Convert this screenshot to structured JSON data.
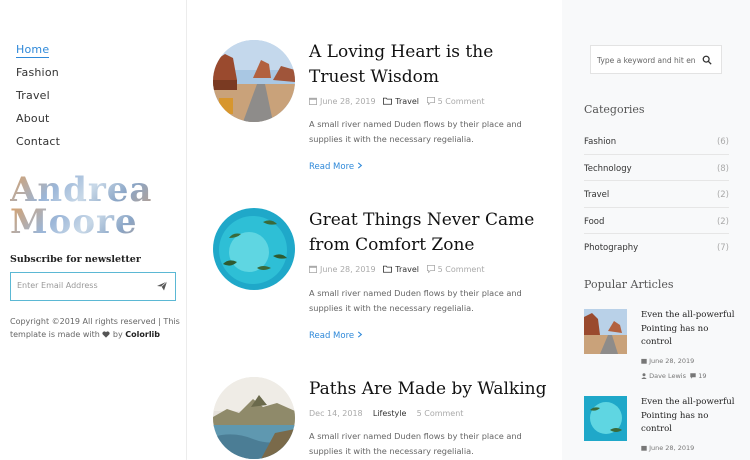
{
  "nav": {
    "items": [
      "Home",
      "Fashion",
      "Travel",
      "About",
      "Contact"
    ],
    "active_index": 0
  },
  "logo": {
    "line1": "Andrea",
    "line2": "Moore"
  },
  "subscribe": {
    "title": "Subscribe for newsletter",
    "placeholder": "Enter Email Address",
    "send_icon": "paper-plane-icon"
  },
  "copyright": {
    "text": "Copyright ©2019 All rights reserved | This template is made with",
    "heart_icon": "heart-icon",
    "by": "by",
    "brand": "Colorlib"
  },
  "posts": [
    {
      "title": "A Loving Heart is the Truest Wisdom",
      "date": "June 28, 2019",
      "category": "Travel",
      "comments": "5 Comment",
      "excerpt": "A small river named Duden flows by their place and supplies it with the necessary regelialia.",
      "read_more": "Read More"
    },
    {
      "title": "Great Things Never Came from Comfort Zone",
      "date": "June 28, 2019",
      "category": "Travel",
      "comments": "5 Comment",
      "excerpt": "A small river named Duden flows by their place and supplies it with the necessary regelialia.",
      "read_more": "Read More"
    },
    {
      "title": "Paths Are Made by Walking",
      "date": "Dec 14, 2018",
      "category": "Lifestyle",
      "comments": "5 Comment",
      "excerpt": "A small river named Duden flows by their place and supplies it with the necessary regelialia."
    }
  ],
  "search": {
    "placeholder": "Type a keyword and hit enter"
  },
  "categories": {
    "title": "Categories",
    "items": [
      {
        "name": "Fashion",
        "count": "(6)"
      },
      {
        "name": "Technology",
        "count": "(8)"
      },
      {
        "name": "Travel",
        "count": "(2)"
      },
      {
        "name": "Food",
        "count": "(2)"
      },
      {
        "name": "Photography",
        "count": "(7)"
      }
    ]
  },
  "popular": {
    "title": "Popular Articles",
    "items": [
      {
        "title": "Even the all-powerful Pointing has no control",
        "date": "June 28, 2019",
        "author": "Dave Lewis",
        "comments": "19"
      },
      {
        "title": "Even the all-powerful Pointing has no control",
        "date": "June 28, 2019"
      }
    ]
  },
  "colors": {
    "accent": "#2f89d9",
    "sidebar_bg": "#f8f9fa",
    "subscribe_border": "#5bb8d4"
  }
}
